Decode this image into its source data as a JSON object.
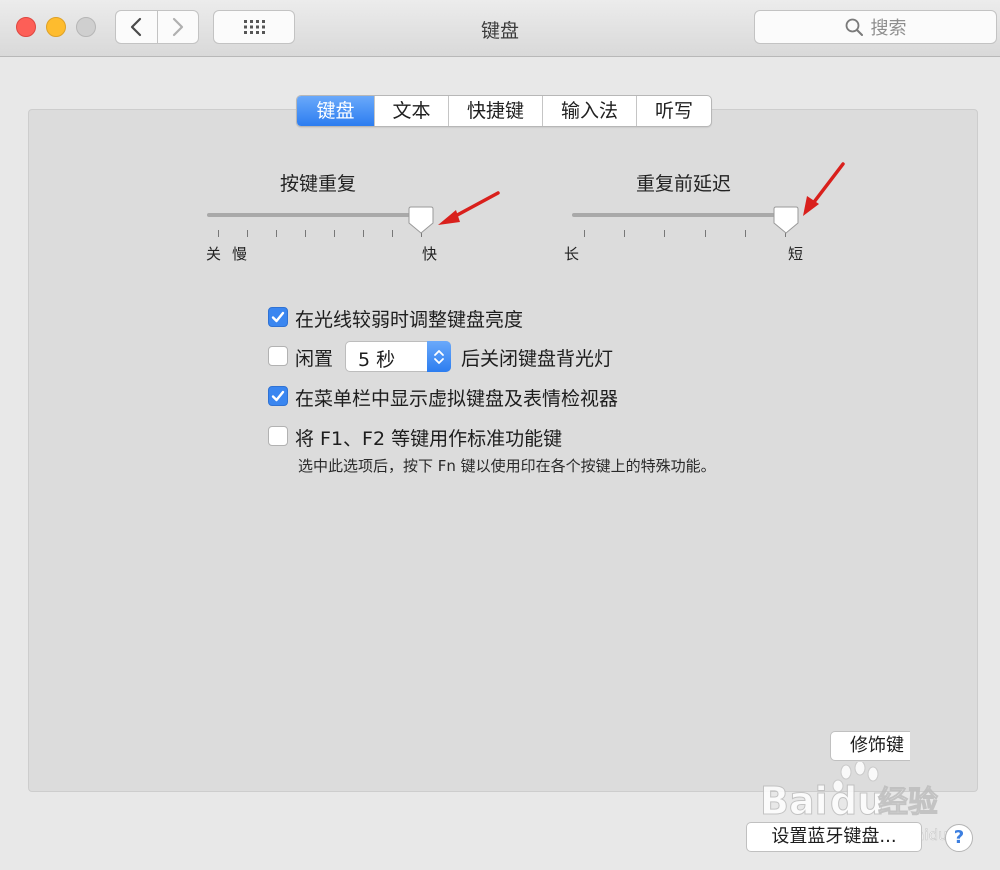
{
  "window": {
    "title": "键盘",
    "search_placeholder": "搜索"
  },
  "tabs": [
    {
      "label": "键盘",
      "active": true
    },
    {
      "label": "文本",
      "active": false
    },
    {
      "label": "快捷键",
      "active": false
    },
    {
      "label": "输入法",
      "active": false
    },
    {
      "label": "听写",
      "active": false
    }
  ],
  "key_repeat": {
    "title": "按键重复",
    "labels": {
      "off": "关",
      "slow": "慢",
      "fast": "快"
    },
    "level": 1.0
  },
  "delay_until_repeat": {
    "title": "重复前延迟",
    "labels": {
      "long": "长",
      "short": "短"
    },
    "level": 1.0
  },
  "options": [
    {
      "label": "在光线较弱时调整键盘亮度",
      "checked": true
    },
    {
      "label_before": "闲置",
      "popup_value": "5 秒",
      "label_after": "后关闭键盘背光灯",
      "checked": false
    },
    {
      "label": "在菜单栏中显示虚拟键盘及表情检视器",
      "checked": true
    },
    {
      "label": "将 F1、F2 等键用作标准功能键",
      "checked": false,
      "hint": "选中此选项后，按下 Fn 键以使用印在各个按键上的特殊功能。"
    }
  ],
  "buttons": {
    "modifier_keys": "修饰键",
    "bluetooth": "设置蓝牙键盘...",
    "help": "?"
  },
  "watermark": {
    "brand": "Bai",
    "brand2": "du",
    "service": "经验",
    "url": "jingyan.baidu.com"
  },
  "colors": {
    "accent": "#2c7df0",
    "annotation_arrow": "#d9201c"
  }
}
